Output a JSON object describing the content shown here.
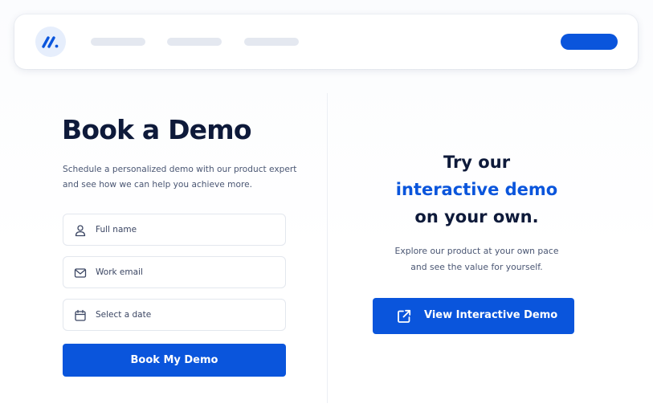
{
  "nav": {
    "logo_icon": "brand-slash-logo-icon",
    "cta_color": "#0a55dc",
    "links": [
      "",
      "",
      ""
    ]
  },
  "book": {
    "title": "Book a Demo",
    "subtitle_line1": "Schedule a personalized demo with our product expert",
    "subtitle_line2": "and see how we can help you achieve more.",
    "fields": [
      {
        "icon": "user-icon",
        "placeholder": "Full name"
      },
      {
        "icon": "mail-icon",
        "placeholder": "Work email"
      },
      {
        "icon": "calendar-icon",
        "placeholder": "Select a date"
      }
    ],
    "submit_label": "Book My Demo"
  },
  "interactive": {
    "title_line1": "Try our",
    "title_accent": "interactive demo",
    "title_line3": "on your own.",
    "subtitle_line1": "Explore our product at your own pace",
    "subtitle_line2": "and see the value for yourself.",
    "button_icon": "external-link-icon",
    "button_label": "View Interactive Demo"
  },
  "colors": {
    "accent": "#0a55dc",
    "heading": "#0e1a3a",
    "body_text": "#4a5673",
    "border": "#e3e7ee"
  }
}
